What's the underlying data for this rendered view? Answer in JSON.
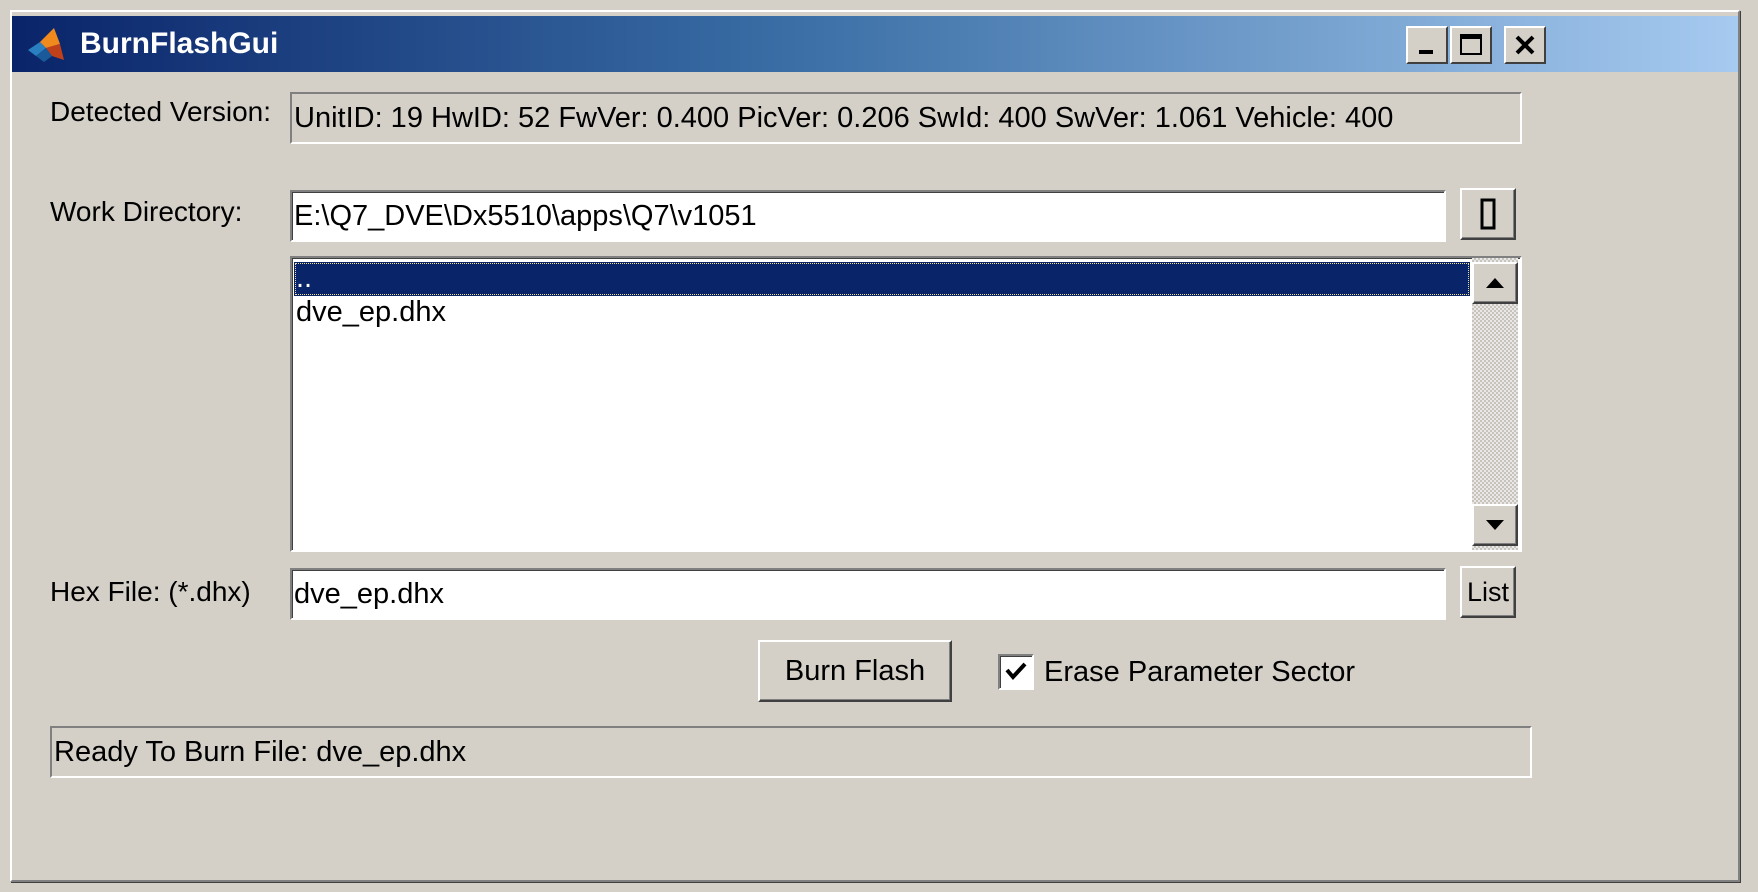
{
  "window": {
    "title": "BurnFlashGui"
  },
  "detected_version": {
    "label": "Detected Version:",
    "value": "UnitID: 19  HwID: 52  FwVer: 0.400  PicVer: 0.206  SwId: 400  SwVer: 1.061  Vehicle: 400"
  },
  "work_directory": {
    "label": "Work Directory:",
    "value": "E:\\Q7_DVE\\Dx5510\\apps\\Q7\\v1051",
    "browse_button_label": "[]"
  },
  "file_list": {
    "items": [
      "..",
      "dve_ep.dhx"
    ],
    "selected_index": 0
  },
  "hex_file": {
    "label": "Hex File: (*.dhx)",
    "value": "dve_ep.dhx",
    "list_button_label": "List"
  },
  "actions": {
    "burn_flash_label": "Burn Flash",
    "erase_checkbox_label": "Erase Parameter Sector",
    "erase_checked": true
  },
  "status": {
    "text": "Ready To Burn File: dve_ep.dhx"
  },
  "colors": {
    "titlebar_start": "#0a246a",
    "titlebar_end": "#a6caf0",
    "selection": "#0a246a",
    "face": "#d4d0c8"
  }
}
